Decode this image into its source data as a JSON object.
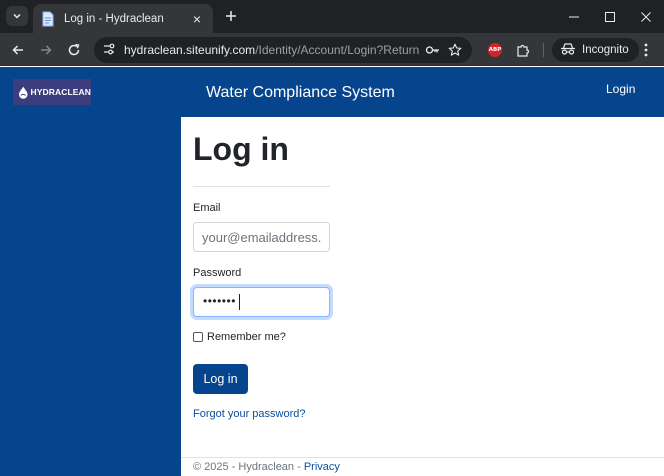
{
  "browser": {
    "tab_title": "Log in - Hydraclean",
    "url_host": "hydraclean.siteunify.com",
    "url_path": "/Identity/Account/Login?ReturnUr...",
    "incognito_label": "Incognito",
    "extension_badge": "ABP"
  },
  "header": {
    "logo_text": "HYDRACLEAN",
    "app_title": "Water Compliance System",
    "login_link": "Login"
  },
  "form": {
    "heading": "Log in",
    "email_label": "Email",
    "email_placeholder": "your@emailaddress.c",
    "password_label": "Password",
    "password_value": "•••••••",
    "remember_label": "Remember me?",
    "remember_checked": false,
    "submit_label": "Log in",
    "forgot_link": "Forgot your password?"
  },
  "footer": {
    "copyright": "© 2025 - Hydraclean -",
    "privacy_link": "Privacy"
  },
  "colors": {
    "brand_blue": "#06458e",
    "logo_bg": "#3b3d7e",
    "link_blue": "#0d4e9b",
    "chrome_dark": "#202124",
    "chrome_toolbar": "#35363a"
  }
}
